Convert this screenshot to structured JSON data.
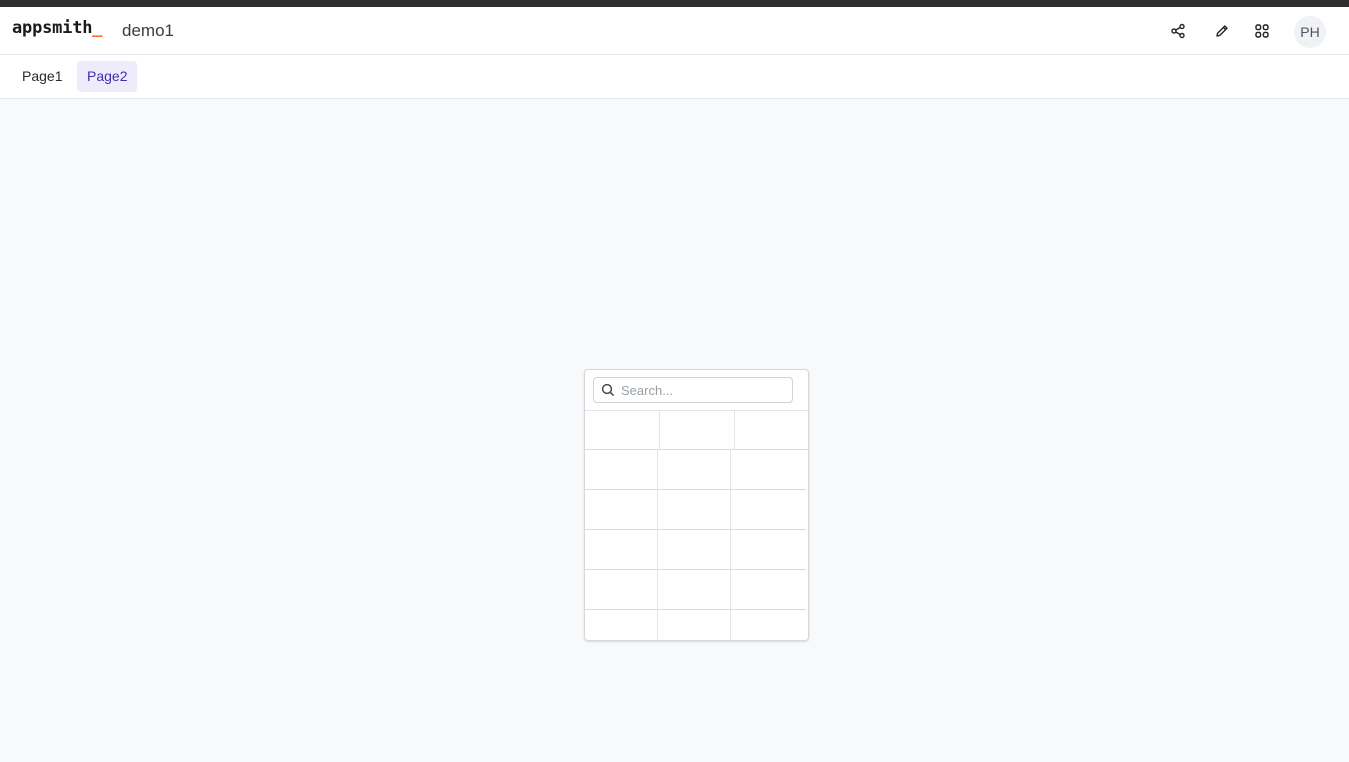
{
  "header": {
    "logo_text": "appsmith",
    "logo_cursor": "_",
    "app_name": "demo1",
    "icons": [
      "share-icon",
      "edit-pencil-icon",
      "apps-grid-icon"
    ],
    "avatar_initials": "PH"
  },
  "tabs": [
    {
      "label": "Page1",
      "active": false
    },
    {
      "label": "Page2",
      "active": true
    }
  ],
  "table_widget": {
    "search_placeholder": "Search...",
    "search_value": "",
    "columns": [
      "",
      "",
      ""
    ],
    "rows": [
      [
        "",
        "",
        ""
      ],
      [
        "",
        "",
        ""
      ],
      [
        "",
        "",
        ""
      ],
      [
        "",
        "",
        ""
      ],
      [
        "",
        "",
        ""
      ]
    ]
  },
  "colors": {
    "brand_accent": "#f86a2b",
    "active_tab_bg": "#eeebfb",
    "active_tab_text": "#3d2fae",
    "canvas_bg": "#f8f9fa",
    "top_strip": "#2f2f2f"
  }
}
